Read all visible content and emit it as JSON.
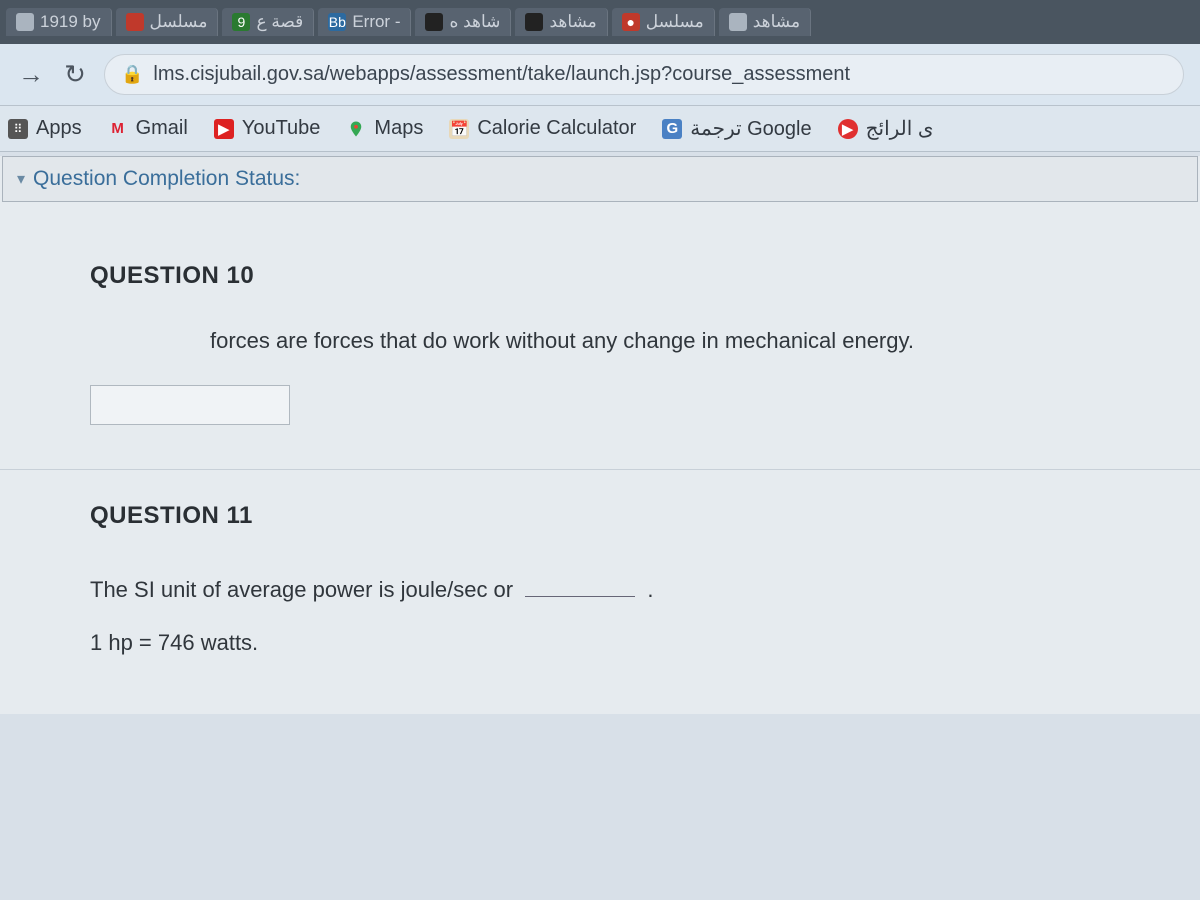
{
  "tabs": [
    {
      "label": "1919 by",
      "iconClass": "light"
    },
    {
      "label": "مسلسل",
      "iconClass": "red"
    },
    {
      "label": "قصة ع",
      "iconClass": "green"
    },
    {
      "label": "Error -",
      "iconClass": "blue",
      "iconText": "Bb"
    },
    {
      "label": "شاهد ه",
      "iconClass": "dark"
    },
    {
      "label": "مشاهد",
      "iconClass": "dark"
    },
    {
      "label": "مسلسل",
      "iconClass": "red",
      "iconText": "●"
    },
    {
      "label": "مشاهد",
      "iconClass": "light"
    }
  ],
  "addressBar": {
    "url": "lms.cisjubail.gov.sa/webapps/assessment/take/launch.jsp?course_assessment"
  },
  "bookmarks": {
    "apps": "Apps",
    "gmail": "Gmail",
    "youtube": "YouTube",
    "maps": "Maps",
    "calc": "Calorie Calculator",
    "gtranslate": "ترجمة Google",
    "trending": "ى الرائج"
  },
  "statusBar": {
    "label": "Question Completion Status:"
  },
  "questions": {
    "q10": {
      "label": "QUESTION 10",
      "text": "forces  are forces that do work without any change in mechanical energy."
    },
    "q11": {
      "label": "QUESTION 11",
      "line1a": "The  SI  unit  of average power is  joule/sec  or ",
      "line1b": " .",
      "line2": "1 hp = 746 watts."
    }
  }
}
